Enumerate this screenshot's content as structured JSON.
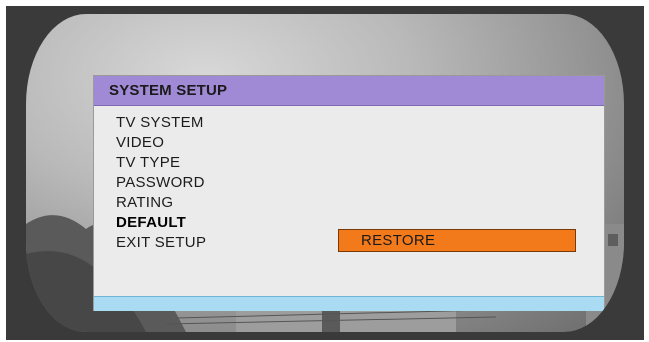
{
  "menu": {
    "title": "SYSTEM SETUP",
    "items": [
      {
        "label": "TV SYSTEM",
        "selected": false
      },
      {
        "label": "VIDEO",
        "selected": false
      },
      {
        "label": "TV TYPE",
        "selected": false
      },
      {
        "label": "PASSWORD",
        "selected": false
      },
      {
        "label": "RATING",
        "selected": false
      },
      {
        "label": "DEFAULT",
        "selected": true
      },
      {
        "label": "EXIT SETUP",
        "selected": false
      }
    ],
    "option": {
      "label": "RESTORE"
    }
  },
  "colors": {
    "title_bar": "#a08ad6",
    "option_highlight": "#f37a1a",
    "status_bar": "#a9dcf2",
    "panel": "#ebebeb"
  }
}
